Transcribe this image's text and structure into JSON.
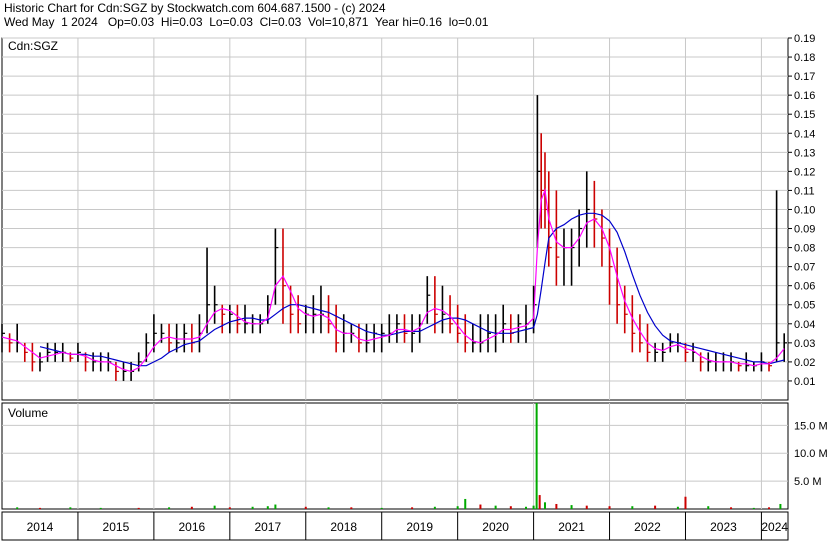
{
  "header": {
    "line1": "Historic Chart for Cdn:SGZ by Stockwatch.com 604.687.1500 - (c) 2024",
    "line2": "Wed May  1 2024   Op=0.03  Hi=0.03  Lo=0.03  Cl=0.03  Vol=10,871  Year hi=0.16  lo=0.01"
  },
  "colors": {
    "price_bar": "#000000",
    "down_bar": "#cc0000",
    "ma_short": "#ff00ff",
    "ma_long": "#0000cc",
    "vol_up": "#00aa00",
    "vol_down": "#cc0000",
    "grid": "#c8c8c8"
  },
  "chart_data": [
    {
      "type": "line",
      "panel": "price",
      "legend": "Cdn:SGZ",
      "y_axis_side": "right",
      "ylim": [
        0,
        0.19
      ],
      "yticks": [
        0.01,
        0.02,
        0.03,
        0.04,
        0.05,
        0.06,
        0.07,
        0.08,
        0.09,
        0.1,
        0.11,
        0.12,
        0.13,
        0.14,
        0.15,
        0.16,
        0.17,
        0.18,
        0.19
      ],
      "ytick_labels": [
        "0.01",
        "0.02",
        "0.03",
        "0.04",
        "0.05",
        "0.06",
        "0.07",
        "0.08",
        "0.09",
        "0.10",
        "0.11",
        "0.12",
        "0.13",
        "0.14",
        "0.15",
        "0.16",
        "0.17",
        "0.18",
        "0.19"
      ],
      "xlim": [
        2014.0,
        2024.35
      ],
      "grid": true,
      "price": {
        "x": [
          2014.0,
          2014.1,
          2014.2,
          2014.3,
          2014.4,
          2014.5,
          2014.6,
          2014.7,
          2014.8,
          2014.9,
          2015.0,
          2015.1,
          2015.2,
          2015.3,
          2015.4,
          2015.5,
          2015.6,
          2015.7,
          2015.8,
          2015.9,
          2016.0,
          2016.1,
          2016.2,
          2016.3,
          2016.4,
          2016.5,
          2016.6,
          2016.7,
          2016.8,
          2016.9,
          2017.0,
          2017.1,
          2017.2,
          2017.3,
          2017.4,
          2017.5,
          2017.6,
          2017.7,
          2017.8,
          2017.9,
          2018.0,
          2018.1,
          2018.2,
          2018.3,
          2018.4,
          2018.5,
          2018.6,
          2018.7,
          2018.8,
          2018.9,
          2019.0,
          2019.1,
          2019.2,
          2019.3,
          2019.4,
          2019.5,
          2019.6,
          2019.7,
          2019.8,
          2019.9,
          2020.0,
          2020.1,
          2020.2,
          2020.3,
          2020.4,
          2020.5,
          2020.6,
          2020.7,
          2020.8,
          2020.9,
          2021.0,
          2021.05,
          2021.1,
          2021.15,
          2021.2,
          2021.3,
          2021.4,
          2021.5,
          2021.6,
          2021.7,
          2021.8,
          2021.9,
          2022.0,
          2022.1,
          2022.2,
          2022.3,
          2022.4,
          2022.5,
          2022.6,
          2022.7,
          2022.8,
          2022.9,
          2023.0,
          2023.1,
          2023.2,
          2023.3,
          2023.4,
          2023.5,
          2023.6,
          2023.7,
          2023.8,
          2023.9,
          2024.0,
          2024.1,
          2024.2,
          2024.3
        ],
        "high": [
          0.04,
          0.035,
          0.04,
          0.03,
          0.03,
          0.025,
          0.03,
          0.03,
          0.03,
          0.025,
          0.03,
          0.025,
          0.025,
          0.025,
          0.025,
          0.02,
          0.02,
          0.02,
          0.025,
          0.035,
          0.045,
          0.04,
          0.04,
          0.04,
          0.04,
          0.04,
          0.045,
          0.08,
          0.06,
          0.05,
          0.05,
          0.05,
          0.05,
          0.045,
          0.045,
          0.055,
          0.09,
          0.09,
          0.06,
          0.055,
          0.05,
          0.055,
          0.06,
          0.055,
          0.05,
          0.045,
          0.04,
          0.04,
          0.04,
          0.04,
          0.04,
          0.045,
          0.045,
          0.045,
          0.045,
          0.045,
          0.065,
          0.065,
          0.06,
          0.055,
          0.05,
          0.045,
          0.04,
          0.045,
          0.045,
          0.045,
          0.05,
          0.045,
          0.045,
          0.05,
          0.06,
          0.16,
          0.14,
          0.13,
          0.12,
          0.11,
          0.09,
          0.09,
          0.1,
          0.12,
          0.115,
          0.1,
          0.09,
          0.08,
          0.06,
          0.055,
          0.045,
          0.04,
          0.03,
          0.03,
          0.035,
          0.035,
          0.03,
          0.03,
          0.025,
          0.025,
          0.025,
          0.025,
          0.025,
          0.02,
          0.025,
          0.02,
          0.025,
          0.02,
          0.11,
          0.035
        ],
        "low": [
          0.025,
          0.025,
          0.025,
          0.02,
          0.015,
          0.015,
          0.02,
          0.02,
          0.02,
          0.02,
          0.02,
          0.015,
          0.015,
          0.015,
          0.015,
          0.01,
          0.01,
          0.01,
          0.015,
          0.02,
          0.025,
          0.03,
          0.025,
          0.025,
          0.025,
          0.025,
          0.025,
          0.035,
          0.04,
          0.035,
          0.035,
          0.035,
          0.035,
          0.035,
          0.035,
          0.04,
          0.05,
          0.04,
          0.035,
          0.035,
          0.035,
          0.035,
          0.035,
          0.035,
          0.025,
          0.025,
          0.03,
          0.025,
          0.025,
          0.025,
          0.025,
          0.03,
          0.03,
          0.03,
          0.025,
          0.03,
          0.04,
          0.035,
          0.035,
          0.035,
          0.03,
          0.025,
          0.025,
          0.025,
          0.025,
          0.025,
          0.03,
          0.03,
          0.03,
          0.03,
          0.035,
          0.08,
          0.09,
          0.09,
          0.07,
          0.06,
          0.06,
          0.06,
          0.07,
          0.08,
          0.08,
          0.07,
          0.05,
          0.04,
          0.035,
          0.025,
          0.025,
          0.02,
          0.02,
          0.02,
          0.025,
          0.025,
          0.02,
          0.02,
          0.015,
          0.015,
          0.015,
          0.015,
          0.015,
          0.015,
          0.015,
          0.015,
          0.015,
          0.015,
          0.02,
          0.02
        ],
        "close": [
          0.035,
          0.03,
          0.03,
          0.025,
          0.02,
          0.02,
          0.025,
          0.025,
          0.025,
          0.022,
          0.025,
          0.02,
          0.02,
          0.02,
          0.02,
          0.015,
          0.015,
          0.015,
          0.02,
          0.03,
          0.035,
          0.035,
          0.03,
          0.03,
          0.035,
          0.03,
          0.035,
          0.05,
          0.05,
          0.045,
          0.045,
          0.04,
          0.04,
          0.04,
          0.04,
          0.05,
          0.08,
          0.06,
          0.045,
          0.04,
          0.045,
          0.045,
          0.045,
          0.04,
          0.03,
          0.035,
          0.035,
          0.03,
          0.03,
          0.035,
          0.035,
          0.035,
          0.04,
          0.035,
          0.035,
          0.04,
          0.055,
          0.045,
          0.045,
          0.04,
          0.035,
          0.03,
          0.03,
          0.03,
          0.035,
          0.035,
          0.04,
          0.035,
          0.04,
          0.04,
          0.05,
          0.12,
          0.11,
          0.1,
          0.08,
          0.075,
          0.08,
          0.08,
          0.09,
          0.1,
          0.095,
          0.085,
          0.07,
          0.05,
          0.045,
          0.035,
          0.03,
          0.025,
          0.025,
          0.025,
          0.03,
          0.03,
          0.025,
          0.025,
          0.02,
          0.02,
          0.02,
          0.02,
          0.02,
          0.018,
          0.018,
          0.018,
          0.02,
          0.018,
          0.03,
          0.03
        ]
      },
      "ma_short": [
        0.033,
        0.032,
        0.031,
        0.028,
        0.025,
        0.022,
        0.023,
        0.024,
        0.025,
        0.024,
        0.024,
        0.023,
        0.021,
        0.02,
        0.02,
        0.018,
        0.016,
        0.015,
        0.017,
        0.022,
        0.028,
        0.032,
        0.033,
        0.032,
        0.032,
        0.032,
        0.033,
        0.04,
        0.046,
        0.048,
        0.047,
        0.044,
        0.041,
        0.04,
        0.04,
        0.043,
        0.06,
        0.065,
        0.057,
        0.048,
        0.045,
        0.044,
        0.045,
        0.043,
        0.037,
        0.035,
        0.035,
        0.032,
        0.031,
        0.032,
        0.033,
        0.034,
        0.037,
        0.037,
        0.036,
        0.038,
        0.046,
        0.048,
        0.047,
        0.044,
        0.039,
        0.034,
        0.031,
        0.03,
        0.032,
        0.034,
        0.037,
        0.037,
        0.038,
        0.039,
        0.043,
        0.08,
        0.105,
        0.11,
        0.095,
        0.083,
        0.08,
        0.08,
        0.085,
        0.093,
        0.095,
        0.09,
        0.08,
        0.065,
        0.052,
        0.043,
        0.036,
        0.03,
        0.027,
        0.026,
        0.028,
        0.029,
        0.027,
        0.026,
        0.023,
        0.021,
        0.02,
        0.02,
        0.02,
        0.019,
        0.019,
        0.018,
        0.019,
        0.019,
        0.022,
        0.027
      ],
      "ma_long": [
        null,
        null,
        null,
        null,
        null,
        0.028,
        0.027,
        0.026,
        0.025,
        0.024,
        0.024,
        0.024,
        0.023,
        0.023,
        0.022,
        0.021,
        0.02,
        0.019,
        0.018,
        0.018,
        0.02,
        0.022,
        0.025,
        0.027,
        0.029,
        0.03,
        0.031,
        0.034,
        0.037,
        0.039,
        0.041,
        0.042,
        0.043,
        0.043,
        0.042,
        0.042,
        0.045,
        0.048,
        0.05,
        0.05,
        0.049,
        0.048,
        0.047,
        0.046,
        0.044,
        0.042,
        0.04,
        0.038,
        0.036,
        0.035,
        0.034,
        0.034,
        0.035,
        0.036,
        0.036,
        0.036,
        0.038,
        0.04,
        0.042,
        0.043,
        0.043,
        0.042,
        0.04,
        0.038,
        0.036,
        0.035,
        0.035,
        0.035,
        0.036,
        0.037,
        0.038,
        0.045,
        0.058,
        0.072,
        0.085,
        0.09,
        0.092,
        0.095,
        0.097,
        0.098,
        0.098,
        0.097,
        0.094,
        0.088,
        0.078,
        0.066,
        0.055,
        0.046,
        0.039,
        0.034,
        0.031,
        0.03,
        0.029,
        0.028,
        0.027,
        0.026,
        0.025,
        0.024,
        0.023,
        0.022,
        0.021,
        0.02,
        0.02,
        0.019,
        0.02,
        0.021
      ]
    },
    {
      "type": "bar",
      "panel": "volume",
      "title": "Volume",
      "y_axis_side": "right",
      "ylim": [
        0,
        19
      ],
      "yticks": [
        5,
        10,
        15
      ],
      "ytick_labels": [
        "5.0 M",
        "10.0 M",
        "15.0 M"
      ],
      "x": [
        2014.2,
        2014.5,
        2014.9,
        2015.3,
        2015.8,
        2016.2,
        2016.5,
        2016.8,
        2017.0,
        2017.3,
        2017.5,
        2017.6,
        2018.0,
        2018.3,
        2018.6,
        2019.0,
        2019.4,
        2019.7,
        2020.0,
        2020.1,
        2020.3,
        2020.5,
        2020.7,
        2020.9,
        2021.0,
        2021.04,
        2021.08,
        2021.15,
        2021.3,
        2021.5,
        2021.7,
        2022.0,
        2022.3,
        2022.6,
        2022.9,
        2023.0,
        2023.3,
        2023.6,
        2023.9,
        2024.1,
        2024.25
      ],
      "values": [
        0.3,
        0.2,
        0.3,
        0.2,
        0.2,
        0.3,
        0.4,
        0.6,
        0.3,
        0.4,
        0.5,
        0.8,
        0.4,
        0.3,
        0.3,
        0.2,
        0.3,
        0.4,
        0.5,
        1.8,
        0.8,
        0.6,
        0.5,
        0.4,
        0.6,
        19.0,
        2.5,
        1.2,
        0.9,
        0.7,
        0.6,
        0.5,
        0.5,
        0.6,
        0.4,
        2.2,
        0.5,
        0.3,
        0.2,
        0.3,
        0.9
      ],
      "up": [
        true,
        false,
        true,
        true,
        false,
        true,
        false,
        true,
        false,
        true,
        true,
        true,
        false,
        true,
        false,
        true,
        false,
        true,
        true,
        true,
        false,
        true,
        false,
        true,
        true,
        true,
        false,
        true,
        false,
        true,
        false,
        false,
        true,
        false,
        true,
        false,
        true,
        false,
        true,
        false,
        true
      ]
    }
  ],
  "x_axis": {
    "labels": [
      "2014",
      "2015",
      "2016",
      "2017",
      "2018",
      "2019",
      "2020",
      "2021",
      "2022",
      "2023",
      "2024"
    ],
    "positions": [
      2014.0,
      2015.0,
      2016.0,
      2017.0,
      2018.0,
      2019.0,
      2020.0,
      2021.0,
      2022.0,
      2023.0,
      2024.0
    ]
  }
}
